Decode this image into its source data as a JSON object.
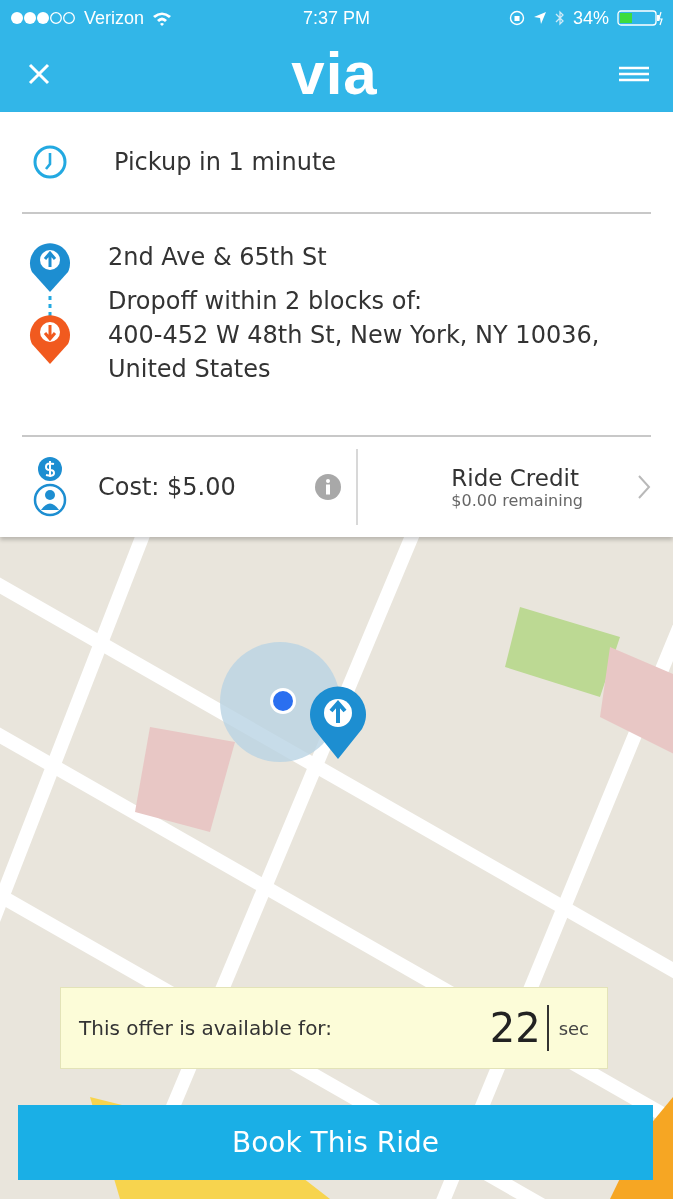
{
  "status_bar": {
    "carrier": "Verizon",
    "time": "7:37 PM",
    "battery": "34%"
  },
  "header": {
    "logo": "via"
  },
  "pickup": {
    "text": "Pickup in 1 minute"
  },
  "route": {
    "pickup_address": "2nd Ave & 65th St",
    "dropoff_label": "Dropoff within 2 blocks of:",
    "dropoff_address": "400-452 W 48th St, New York, NY  10036, United States"
  },
  "cost": {
    "text": "Cost: $5.00",
    "payment_title": "Ride Credit",
    "payment_detail": "$0.00 remaining"
  },
  "offer": {
    "text": "This offer is available for:",
    "seconds": "22",
    "unit": "sec"
  },
  "book_button": "Book This Ride"
}
